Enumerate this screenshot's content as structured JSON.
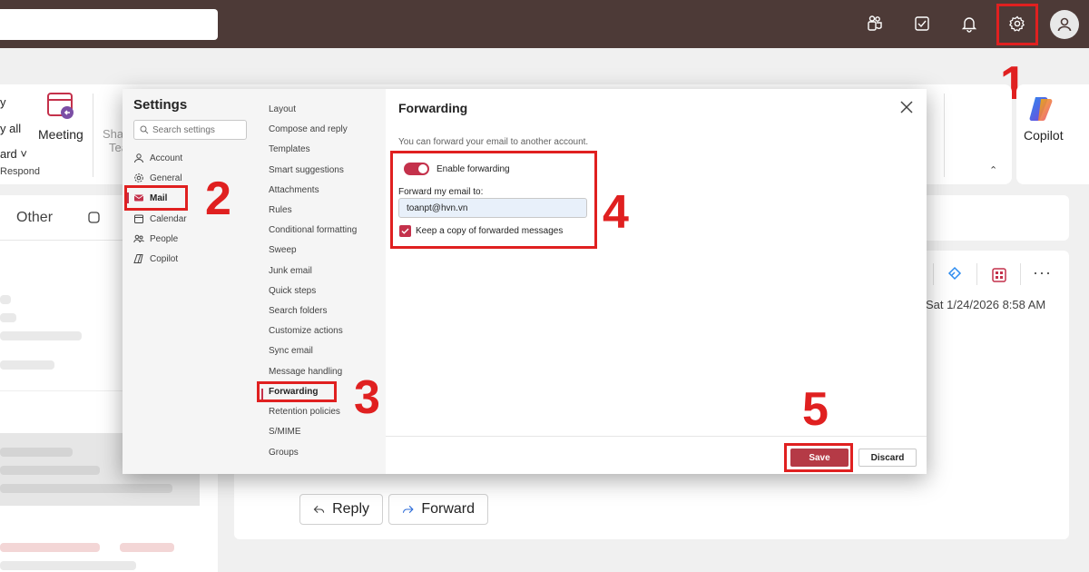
{
  "topbar": {
    "icons": [
      "teams-icon",
      "todo-icon",
      "bell-icon",
      "gear-icon",
      "avatar-icon"
    ]
  },
  "ribbon": {
    "reply_all_partial": "y all",
    "forward_partial": "ard",
    "respond_label": "Respond",
    "meeting_label": "Meeting",
    "share_partial": "Sha",
    "teams_partial": "Tea",
    "copilot_label": "Copilot"
  },
  "mail_list": {
    "tab_other": "Other"
  },
  "reading": {
    "timestamp": "Sat 1/24/2026 8:58 AM",
    "reply_label": "Reply",
    "forward_label": "Forward"
  },
  "settings": {
    "title": "Settings",
    "search_placeholder": "Search settings",
    "categories": [
      {
        "label": "Account",
        "icon": "person-icon"
      },
      {
        "label": "General",
        "icon": "gear-icon"
      },
      {
        "label": "Mail",
        "icon": "mail-icon"
      },
      {
        "label": "Calendar",
        "icon": "calendar-icon"
      },
      {
        "label": "People",
        "icon": "people-icon"
      },
      {
        "label": "Copilot",
        "icon": "copilot-icon"
      }
    ],
    "selected_category": "Mail",
    "subitems": [
      "Layout",
      "Compose and reply",
      "Templates",
      "Smart suggestions",
      "Attachments",
      "Rules",
      "Conditional formatting",
      "Sweep",
      "Junk email",
      "Quick steps",
      "Search folders",
      "Customize actions",
      "Sync email",
      "Message handling",
      "Forwarding",
      "Retention policies",
      "S/MIME",
      "Groups"
    ],
    "selected_subitem": "Forwarding"
  },
  "forwarding": {
    "heading": "Forwarding",
    "description": "You can forward your email to another account.",
    "enable_label": "Enable forwarding",
    "enabled": true,
    "forward_to_label": "Forward my email to:",
    "forward_to_value": "toanpt@hvn.vn",
    "keep_copy_label": "Keep a copy of forwarded messages",
    "keep_copy": true,
    "save_label": "Save",
    "discard_label": "Discard"
  },
  "steps": [
    "1",
    "2",
    "3",
    "4",
    "5"
  ],
  "colors": {
    "topbar": "#4d3a37",
    "accent": "#c4314b",
    "annotation": "#e02020"
  }
}
